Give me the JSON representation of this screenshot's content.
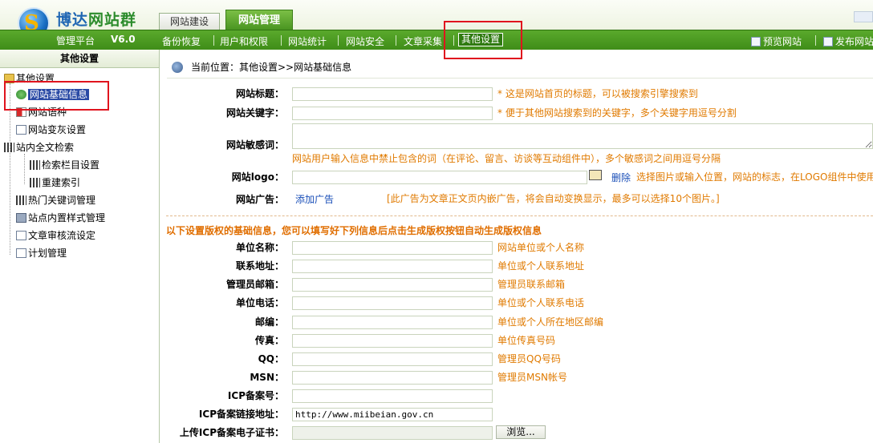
{
  "header": {
    "logo_mark": "S",
    "logo_title_a": "博达",
    "logo_title_b": "网站群",
    "platform_label": "管理平台",
    "version": "V6.0",
    "tabs": [
      {
        "label": "网站建设"
      },
      {
        "label": "网站管理"
      }
    ],
    "nav": [
      {
        "label": "备份恢复"
      },
      {
        "label": "用户和权限"
      },
      {
        "label": "网站统计"
      },
      {
        "label": "网站安全"
      },
      {
        "label": "文章采集"
      },
      {
        "label": "其他设置"
      }
    ],
    "preview_label": "预览网站",
    "publish_label": "发布网站"
  },
  "sidebar": {
    "title": "其他设置",
    "items": [
      {
        "label": "其他设置"
      },
      {
        "label": "网站基础信息"
      },
      {
        "label": "网站语种"
      },
      {
        "label": "网站变灰设置"
      },
      {
        "label": "站内全文检索"
      },
      {
        "label": "检索栏目设置"
      },
      {
        "label": "重建索引"
      },
      {
        "label": "热门关键词管理"
      },
      {
        "label": "站点内置样式管理"
      },
      {
        "label": "文章审核流设定"
      },
      {
        "label": "计划管理"
      }
    ]
  },
  "main": {
    "breadcrumb": "当前位置：其他设置>>网站基础信息",
    "fields": {
      "site_title": {
        "label": "网站标题：",
        "value": "",
        "hint": "* 这是网站首页的标题，可以被搜索引擎搜索到"
      },
      "site_keywords": {
        "label": "网站关键字：",
        "value": "",
        "hint": "* 便于其他网站搜索到的关键字，多个关键字用逗号分割"
      },
      "sensitive_words": {
        "label": "网站敏感词：",
        "value": "",
        "hint": "网站用户输入信息中禁止包含的词（在评论、留言、访谈等互动组件中），多个敏感词之间用逗号分隔"
      },
      "site_logo": {
        "label": "网站logo：",
        "value": "",
        "delete_label": "删除",
        "hint": "选择图片或输入位置，网站的标志，在LOGO组件中使用"
      },
      "site_ad": {
        "label": "网站广告：",
        "add_label": "添加广告",
        "hint": "[此广告为文章正文页内嵌广告，将会自动变换显示，最多可以选择10个图片。]"
      }
    },
    "section_title": "以下设置版权的基础信息，您可以填写好下列信息后点击生成版权按钮自动生成版权信息",
    "copyright_fields": [
      {
        "label": "单位名称：",
        "value": "",
        "hint": "网站单位或个人名称"
      },
      {
        "label": "联系地址：",
        "value": "",
        "hint": "单位或个人联系地址"
      },
      {
        "label": "管理员邮箱：",
        "value": "",
        "hint": "管理员联系邮箱"
      },
      {
        "label": "单位电话：",
        "value": "",
        "hint": "单位或个人联系电话"
      },
      {
        "label": "邮编：",
        "value": "",
        "hint": "单位或个人所在地区邮编"
      },
      {
        "label": "传真：",
        "value": "",
        "hint": "单位传真号码"
      },
      {
        "label": "QQ：",
        "value": "",
        "hint": "管理员QQ号码"
      },
      {
        "label": "MSN：",
        "value": "",
        "hint": "管理员MSN帐号"
      },
      {
        "label": "ICP备案号：",
        "value": "",
        "hint": ""
      },
      {
        "label": "ICP备案链接地址：",
        "value": "http://www.miibeian.gov.cn",
        "hint": ""
      },
      {
        "label": "上传ICP备案电子证书：",
        "value": "",
        "hint": ""
      }
    ],
    "browse_label": "浏览..."
  },
  "colors": {
    "accent_green": "#4a9521",
    "hint_orange": "#e07a00",
    "highlight_red": "#e0141e",
    "link_blue": "#1a4fb8"
  },
  "icons": [
    "logo-icon",
    "preview-icon",
    "publish-icon",
    "folder-icon",
    "globe-icon",
    "flag-icon",
    "page-icon",
    "bars-icon",
    "book-icon",
    "breadcrumb-icon",
    "folder-open-icon"
  ]
}
